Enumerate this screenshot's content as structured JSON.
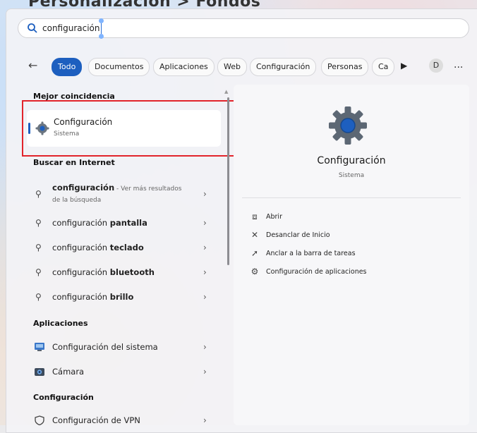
{
  "background_text": "Personalización > Fondos",
  "search": {
    "value": "configuración"
  },
  "filters": {
    "back_icon": "back-arrow-icon",
    "chips": [
      "Todo",
      "Documentos",
      "Aplicaciones",
      "Web",
      "Configuración",
      "Personas",
      "Ca"
    ],
    "more_icon": "play-icon",
    "avatar": "D",
    "overflow": "..."
  },
  "left": {
    "best_match_header": "Mejor coincidencia",
    "best_match": {
      "title": "Configuración",
      "subtitle": "Sistema",
      "icon": "gear-icon"
    },
    "web_header": "Buscar en Internet",
    "web_first": {
      "bold": "configuración",
      "tail": " - Ver más resultados",
      "line2": "de la búsqueda"
    },
    "web_items": [
      {
        "prefix": "configuración ",
        "bold": "pantalla"
      },
      {
        "prefix": "configuración ",
        "bold": "teclado"
      },
      {
        "prefix": "configuración ",
        "bold": "bluetooth"
      },
      {
        "prefix": "configuración ",
        "bold": "brillo"
      }
    ],
    "apps_header": "Aplicaciones",
    "apps": [
      {
        "label": "Configuración del sistema",
        "icon": "system-settings-icon"
      },
      {
        "label": "Cámara",
        "icon": "camera-icon"
      }
    ],
    "config_header": "Configuración",
    "config_items": [
      {
        "label": "Configuración de VPN",
        "icon": "shield-icon"
      }
    ]
  },
  "right": {
    "title": "Configuración",
    "subtitle": "Sistema",
    "actions": [
      {
        "label": "Abrir",
        "icon": "open-external-icon"
      },
      {
        "label": "Desanclar de Inicio",
        "icon": "unpin-icon"
      },
      {
        "label": "Anclar a la barra de tareas",
        "icon": "pin-icon"
      },
      {
        "label": "Configuración de aplicaciones",
        "icon": "gear-icon"
      }
    ]
  },
  "colors": {
    "accent": "#1d5fbf",
    "highlight_box": "#e2242b"
  }
}
